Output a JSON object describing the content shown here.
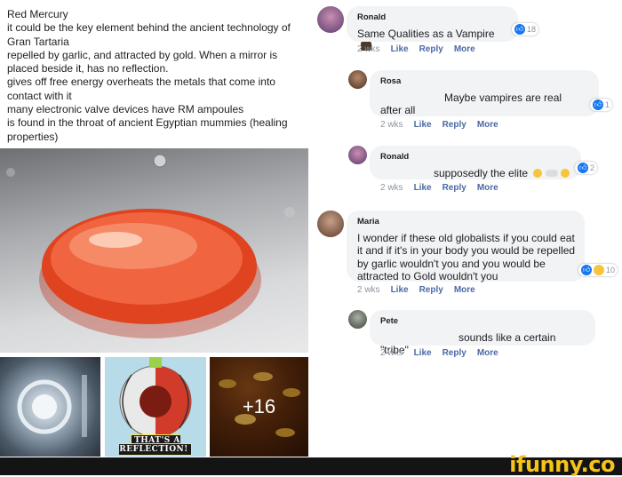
{
  "post": {
    "lines": [
      "Red Mercury",
      "it could be the key element behind the ancient technology of Gran Tartaria",
      "repelled by garlic, and attracted by gold. When a mirror is placed beside it, has no reflection.",
      "gives off free energy overheats the metals that come into contact with it",
      "many electronic valve devices have RM ampoules",
      "is found in the throat of ancient Egyptian mummies (healing properties)"
    ],
    "more_photos": "+16",
    "thumb_caption": "THAT'S A REFLECTION!"
  },
  "comments": [
    {
      "name": "Ronald",
      "text": "Same Qualities as a Vampire",
      "reaction_count": "18",
      "time": "2 wks",
      "like": "Like",
      "reply": "Reply",
      "more": "More"
    },
    {
      "name": "Rosa",
      "text": "Maybe vampires are real after all",
      "reaction_count": "1",
      "time": "2 wks",
      "like": "Like",
      "reply": "Reply",
      "more": "More"
    },
    {
      "name": "Ronald",
      "text": "supposedly the elite",
      "reaction_count": "2",
      "time": "2 wks",
      "like": "Like",
      "reply": "Reply",
      "more": "More"
    },
    {
      "name": "Maria",
      "text": "I wonder if these old globalists if you could eat it and if it's in your body you would be repelled by garlic wouldn't you and you would be attracted to Gold wouldn't you",
      "reaction_count": "10",
      "time": "2 wks",
      "like": "Like",
      "reply": "Reply",
      "more": "More"
    },
    {
      "name": "Pete",
      "text": "sounds like a certain \"tribe\"",
      "time": "2 wks",
      "like": "Like",
      "reply": "Reply",
      "more": "More"
    }
  ],
  "watermark": "ifunny.co",
  "colors": {
    "like_blue": "#1877f2",
    "action_blue": "#4b6aa6",
    "bubble_gray": "#f2f3f5",
    "meta_gray": "#8d949e",
    "ifunny_yellow": "#f5c31a"
  }
}
